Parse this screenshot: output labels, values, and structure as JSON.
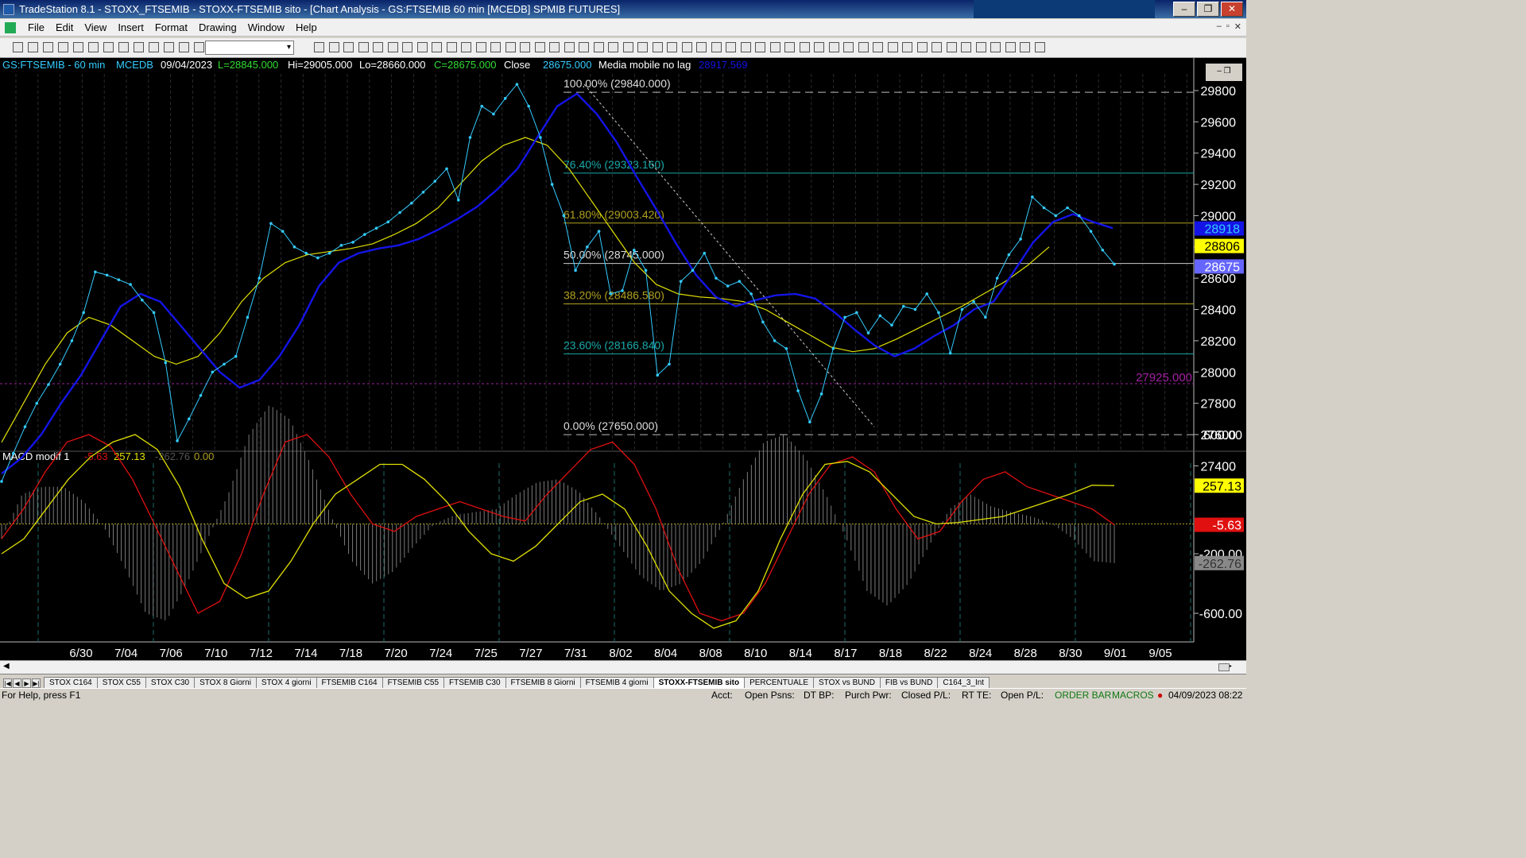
{
  "window": {
    "title": "TradeStation 8.1 - STOXX_FTSEMIB - STOXX-FTSEMIB sito - [Chart Analysis - GS:FTSEMIB  60 min  [MCEDB] SPMIB FUTURES]",
    "buttons": [
      "–",
      "❐",
      "✕"
    ]
  },
  "menu": {
    "items": [
      "File",
      "Edit",
      "View",
      "Insert",
      "Format",
      "Drawing",
      "Window",
      "Help"
    ],
    "mdi_buttons": [
      "–",
      "▫",
      "✕"
    ]
  },
  "price_header": {
    "symbol": "GS:FTSEMIB - 60 min",
    "mode": "MCEDB",
    "date": "09/04/2023",
    "last": "L=28845.000",
    "high": "Hi=29005.000",
    "low": "Lo=28660.000",
    "close": "C=28675.000",
    "close_label": "Close",
    "close_value": "28675.000",
    "indicator_name": "Media mobile no lag",
    "indicator_value": "28917.569"
  },
  "macd_header": {
    "name": "MACD modif 1",
    "v1": "-5.63",
    "v2": "257.13",
    "v3": "-262.76",
    "v4": "0.00"
  },
  "colors": {
    "background": "#000000",
    "price": "#33ccff",
    "blue_ma": "#1414e6",
    "yellow_ma": "#e0e000",
    "macd_red": "#e01010",
    "macd_yellow": "#e0e000",
    "histogram": "#7a7a7a",
    "fib_teal": "#1aa8a8",
    "fib_olive": "#b0a020",
    "purple_line": "#a020a0"
  },
  "chart_data": [
    {
      "type": "line",
      "title": "GS:FTSEMIB - 60 min",
      "x_tick_labels": [
        "6/30",
        "7/04",
        "7/06",
        "7/10",
        "7/12",
        "7/14",
        "7/18",
        "7/20",
        "7/24",
        "7/25",
        "7/27",
        "7/31",
        "8/02",
        "8/04",
        "8/08",
        "8/10",
        "8/14",
        "8/17",
        "8/18",
        "8/22",
        "8/24",
        "8/28",
        "8/30",
        "9/01",
        "9/05"
      ],
      "ylim": [
        27300,
        29950
      ],
      "y_ticks": [
        27400,
        27600,
        27800,
        28000,
        28200,
        28400,
        28600,
        28800,
        29000,
        29200,
        29400,
        29600,
        29800
      ],
      "series": [
        {
          "values": [
            27300,
            27480,
            27650,
            27800,
            27920,
            28050,
            28200,
            28380,
            28640,
            28620,
            28590,
            28560,
            28460,
            28380,
            28060,
            27560,
            27700,
            27850,
            28000,
            28050,
            28100,
            28350,
            28600,
            28950,
            28900,
            28800,
            28760,
            28730,
            28760,
            28810,
            28830,
            28880,
            28920,
            28960,
            29020,
            29080,
            29150,
            29220,
            29300,
            29100,
            29500,
            29700,
            29650,
            29750,
            29840,
            29700,
            29500,
            29200,
            29000,
            28650,
            28800,
            28900,
            28500,
            28520,
            28780,
            28650,
            27980,
            28050,
            28580,
            28650,
            28760,
            28600,
            28550,
            28580,
            28500,
            28320,
            28200,
            28150,
            27880,
            27680,
            27860,
            28150,
            28350,
            28380,
            28250,
            28360,
            28300,
            28420,
            28400,
            28500,
            28380,
            28120,
            28400,
            28450,
            28350,
            28600,
            28750,
            28850,
            29120,
            29050,
            29000,
            29050,
            29000,
            28900,
            28780,
            28690
          ]
        },
        {
          "name": "Media mobile no lag",
          "values": [
            27350,
            27450,
            27600,
            27800,
            27980,
            28200,
            28420,
            28500,
            28450,
            28300,
            28150,
            28000,
            27900,
            27950,
            28100,
            28300,
            28550,
            28700,
            28760,
            28790,
            28810,
            28850,
            28910,
            28980,
            29060,
            29170,
            29300,
            29500,
            29700,
            29780,
            29650,
            29470,
            29250,
            29040,
            28820,
            28620,
            28480,
            28420,
            28460,
            28490,
            28500,
            28470,
            28380,
            28270,
            28170,
            28100,
            28150,
            28230,
            28300,
            28400,
            28450,
            28640,
            28830,
            28960,
            29010,
            28960,
            28920
          ]
        },
        {
          "values": [
            27550,
            27800,
            28050,
            28250,
            28350,
            28300,
            28200,
            28100,
            28050,
            28100,
            28250,
            28450,
            28600,
            28700,
            28750,
            28770,
            28790,
            28820,
            28880,
            28950,
            29050,
            29200,
            29350,
            29450,
            29500,
            29450,
            29300,
            29100,
            28900,
            28700,
            28560,
            28500,
            28480,
            28470,
            28450,
            28400,
            28320,
            28240,
            28160,
            28130,
            28150,
            28210,
            28280,
            28350,
            28420,
            28500,
            28580,
            28680,
            28800
          ]
        }
      ],
      "fibonacci": [
        {
          "label": "100.00% (29840.000)",
          "value": 29840
        },
        {
          "label": "76.40% (29323.160)",
          "value": 29323.16
        },
        {
          "label": "61.80% (29003.420)",
          "value": 29003.42
        },
        {
          "label": "50.00% (28745.000)",
          "value": 28745
        },
        {
          "label": "38.20% (28486.580)",
          "value": 28486.58
        },
        {
          "label": "23.60% (28166.840)",
          "value": 28166.84
        },
        {
          "label": "0.00% (27650.000)",
          "value": 27650
        }
      ],
      "reference_line": {
        "label": "27925.000",
        "value": 27925
      },
      "axis_markers": [
        {
          "label": "28918",
          "value": 28918
        },
        {
          "label": "28806",
          "value": 28806
        },
        {
          "label": "28675",
          "value": 28675
        }
      ]
    },
    {
      "type": "line",
      "title": "MACD modif 1",
      "ylim": [
        -800,
        900
      ],
      "y_ticks": [
        600,
        -200,
        -600
      ],
      "y_tick_labels": [
        "600.00",
        "-200.00",
        "-600.00"
      ],
      "series": [
        {
          "values": [
            -100,
            100,
            350,
            550,
            600,
            520,
            300,
            0,
            -300,
            -600,
            -520,
            -200,
            200,
            550,
            600,
            450,
            200,
            0,
            -50,
            50,
            100,
            150,
            100,
            50,
            20,
            200,
            350,
            500,
            550,
            400,
            100,
            -300,
            -600,
            -650,
            -600,
            -400,
            -100,
            200,
            400,
            450,
            350,
            100,
            -100,
            -50,
            150,
            300,
            350,
            250,
            200,
            150,
            100,
            -5.63
          ]
        },
        {
          "values": [
            -200,
            -100,
            100,
            300,
            450,
            550,
            600,
            500,
            250,
            -100,
            -400,
            -500,
            -450,
            -250,
            0,
            200,
            300,
            400,
            400,
            300,
            150,
            -50,
            -200,
            -250,
            -150,
            0,
            150,
            200,
            100,
            -150,
            -450,
            -600,
            -700,
            -650,
            -450,
            -100,
            200,
            400,
            420,
            350,
            200,
            50,
            0,
            10,
            30,
            50,
            100,
            150,
            200,
            260,
            257.13
          ]
        }
      ],
      "histogram_values": [
        -100,
        200,
        250,
        250,
        150,
        -30,
        -300,
        -600,
        -650,
        -400,
        -100,
        200,
        600,
        800,
        700,
        400,
        50,
        -250,
        -400,
        -320,
        -150,
        0,
        60,
        80,
        100,
        200,
        280,
        300,
        220,
        50,
        -150,
        -350,
        -450,
        -400,
        -250,
        0,
        300,
        550,
        600,
        450,
        200,
        -100,
        -450,
        -550,
        -400,
        -150,
        100,
        200,
        120,
        80,
        50,
        0,
        -100,
        -250,
        -262.76
      ],
      "markers": [
        {
          "label": "257.13",
          "value": 257.13
        },
        {
          "label": "-5.63",
          "value": -5.63
        },
        {
          "label": "-262.76",
          "value": -262.76
        }
      ]
    }
  ],
  "scrollbar": {
    "left": "◀",
    "right": "▶"
  },
  "tabs": {
    "nav": [
      "|◀",
      "◀",
      "▶",
      "▶|"
    ],
    "items": [
      "STOX C164",
      "STOX C55",
      "STOX  C30",
      "STOX  8 Giorni",
      "STOX 4 giorni",
      "FTSEMIB C164",
      "FTSEMIB C55",
      "FTSEMIB C30",
      "FTSEMIB  8 Giorni",
      "FTSEMIB  4 giorni",
      "STOXX-FTSEMIB sito",
      "PERCENTUALE",
      "STOX vs BUND",
      "FIB vs BUND",
      "C164_3_Int"
    ],
    "active": "STOXX-FTSEMIB sito"
  },
  "status": {
    "help": "For Help, press F1",
    "acct": "Acct:",
    "open_psns": "Open Psns:",
    "dt_bp": "DT BP:",
    "purch_pwr": "Purch Pwr:",
    "closed_pl": "Closed P/L:",
    "rt_te": "RT TE:",
    "open_pl": "Open P/L:",
    "order_bar": "ORDER BAR",
    "macros": "MACROS",
    "datetime": "04/09/2023 08:22"
  }
}
